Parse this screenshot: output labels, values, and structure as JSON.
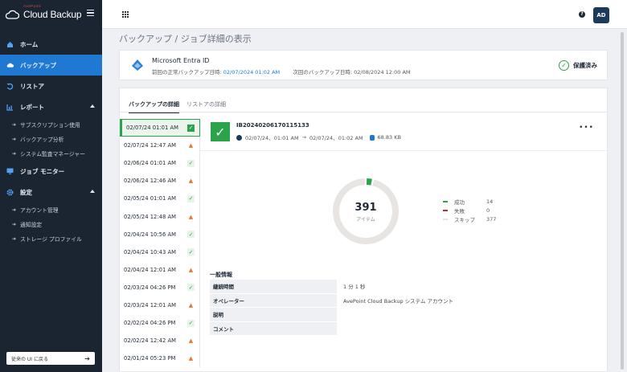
{
  "app": {
    "brand": "AvePoint",
    "name": "Cloud Backup"
  },
  "sidebar": {
    "items": [
      {
        "label": "ホーム",
        "icon": "home-icon"
      },
      {
        "label": "バックアップ",
        "icon": "cloud-icon",
        "active": true
      },
      {
        "label": "リストア",
        "icon": "restore-icon"
      },
      {
        "label": "レポート",
        "icon": "chart-icon",
        "expanded": true
      },
      {
        "label": "ジョブ モニター",
        "icon": "monitor-icon"
      },
      {
        "label": "設定",
        "icon": "gear-icon",
        "expanded": true
      }
    ],
    "report_sub": [
      "サブスクリプション使用",
      "バックアップ分析",
      "システム監査マネージャー"
    ],
    "settings_sub": [
      "アカウント管理",
      "通知設定",
      "ストレージ プロファイル"
    ],
    "old_ui_label": "従来の UI に戻る"
  },
  "header": {
    "avatar": "AD",
    "help": "?"
  },
  "breadcrumb": {
    "root": "バックアップ",
    "sep": "/",
    "current": "ジョブ詳細の表示"
  },
  "summary": {
    "service": "Microsoft Entra ID",
    "last_ok_label": "前回の正常バックアップ日時:",
    "last_ok_value": "02/07/2024 01:02 AM",
    "next_label": "次回のバックアップ日時:",
    "next_value": "02/08/2024 12:00 AM",
    "status": "保護済み"
  },
  "tabs": [
    "バックアップの詳細",
    "リストアの詳細"
  ],
  "jobs": [
    {
      "date": "02/07/24",
      "time": "01:01 AM",
      "status": "success"
    },
    {
      "date": "02/07/24",
      "time": "12:47 AM",
      "status": "warning"
    },
    {
      "date": "02/06/24",
      "time": "01:01 AM",
      "status": "success"
    },
    {
      "date": "02/06/24",
      "time": "12:46 AM",
      "status": "warning"
    },
    {
      "date": "02/05/24",
      "time": "01:01 AM",
      "status": "success"
    },
    {
      "date": "02/05/24",
      "time": "12:48 AM",
      "status": "warning"
    },
    {
      "date": "02/04/24",
      "time": "10:56 AM",
      "status": "success"
    },
    {
      "date": "02/04/24",
      "time": "10:43 AM",
      "status": "success"
    },
    {
      "date": "02/04/24",
      "time": "12:01 AM",
      "status": "warning"
    },
    {
      "date": "02/03/24",
      "time": "04:26 PM",
      "status": "success"
    },
    {
      "date": "02/03/24",
      "time": "12:01 AM",
      "status": "warning"
    },
    {
      "date": "02/02/24",
      "time": "04:26 PM",
      "status": "success"
    },
    {
      "date": "02/02/24",
      "time": "12:42 AM",
      "status": "warning"
    },
    {
      "date": "02/01/24",
      "time": "05:23 PM",
      "status": "warning"
    }
  ],
  "job_detail": {
    "id": "IB20240206170115133",
    "start": "02/07/24、01:01 AM",
    "end": "02/07/24、01:02 AM",
    "size": "68.83 KB",
    "more": "•••"
  },
  "chart_data": {
    "type": "pie",
    "total": 391,
    "total_label": "アイテム",
    "series": [
      {
        "name": "成功",
        "value": 14,
        "color": "#2ba34a"
      },
      {
        "name": "失敗",
        "value": 0,
        "color": "#c62828"
      },
      {
        "name": "スキップ",
        "value": 377,
        "color": "#e8e4e1"
      }
    ]
  },
  "general": {
    "title": "一般情報",
    "rows": [
      {
        "key": "継続時間",
        "value": "1 分 1 秒"
      },
      {
        "key": "オペレーター",
        "value": "AvePoint Cloud Backup システム アカウント"
      },
      {
        "key": "説明",
        "value": ""
      },
      {
        "key": "コメント",
        "value": ""
      }
    ]
  }
}
